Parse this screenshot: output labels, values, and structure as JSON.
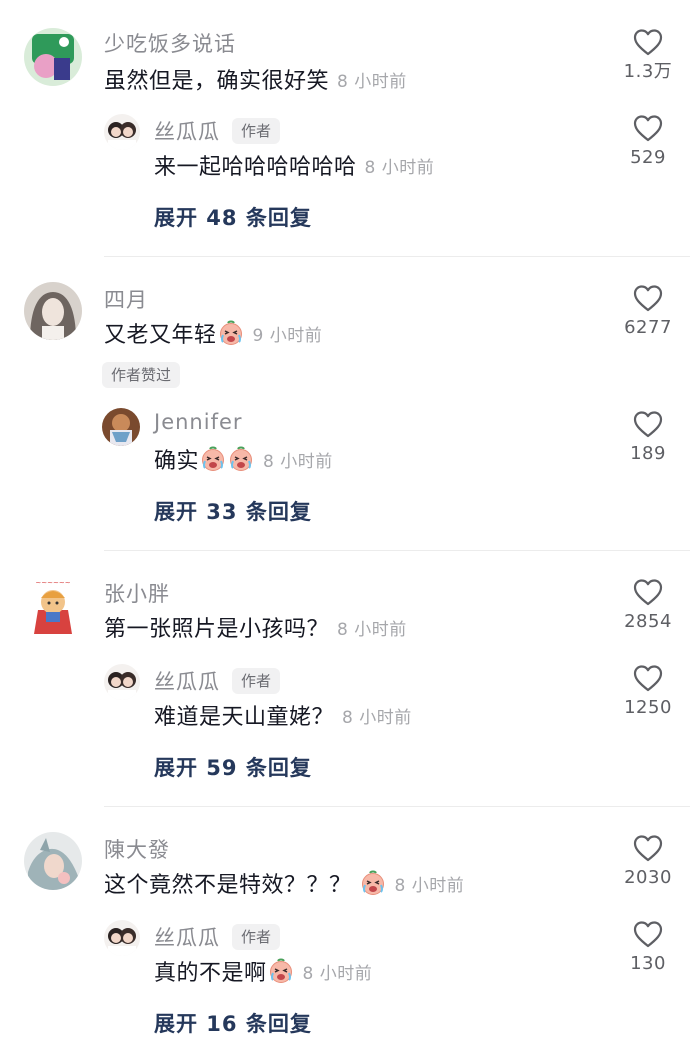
{
  "threads": [
    {
      "user": "少吃饭多说话",
      "text": "虽然但是，确实很好笑",
      "time": "8 小时前",
      "likes": "1.3万",
      "reply": {
        "user": "丝瓜瓜",
        "author_tag": "作者",
        "text": "来一起哈哈哈哈哈哈",
        "time": "8 小时前",
        "likes": "529"
      },
      "expand": "展开 48 条回复"
    },
    {
      "user": "四月",
      "text": "又老又年轻",
      "time": "9 小时前",
      "likes": "6277",
      "liked_tag": "作者赞过",
      "reply": {
        "user": "Jennifer",
        "text": "确实",
        "time": "8 小时前",
        "likes": "189"
      },
      "expand": "展开 33 条回复"
    },
    {
      "user": "张小胖",
      "text": "第一张照片是小孩吗？",
      "time": "8 小时前",
      "likes": "2854",
      "reply": {
        "user": "丝瓜瓜",
        "author_tag": "作者",
        "text": "难道是天山童姥？",
        "time": "8 小时前",
        "likes": "1250"
      },
      "expand": "展开 59 条回复"
    },
    {
      "user": "陳大發",
      "text": "这个竟然不是特效？？？",
      "time": "8 小时前",
      "likes": "2030",
      "reply": {
        "user": "丝瓜瓜",
        "author_tag": "作者",
        "text": "真的不是啊",
        "time": "8 小时前",
        "likes": "130"
      },
      "expand": "展开 16 条回复"
    }
  ],
  "colors": {
    "username": "#8a8b91",
    "text": "#161823",
    "time": "#a6a7ab",
    "expand": "#25385b",
    "tag_bg": "#f1f1f2"
  },
  "icons": {
    "like": "heart-outline-icon",
    "emoji": "crying-laughing-emoji-icon"
  }
}
